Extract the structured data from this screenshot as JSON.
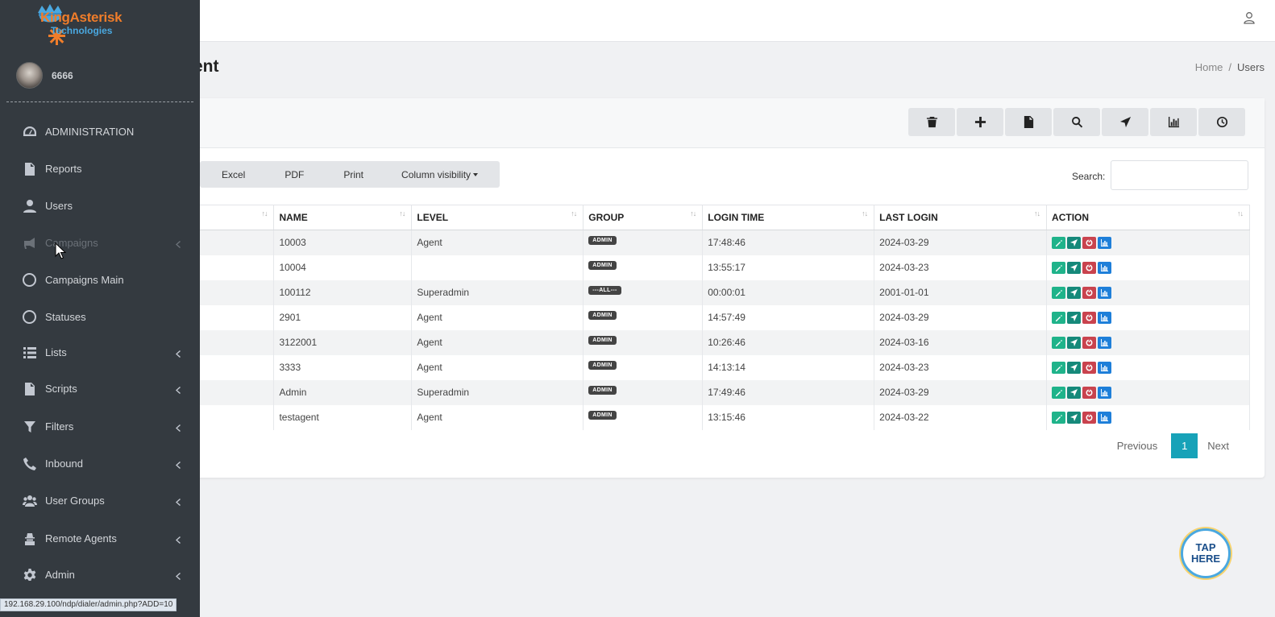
{
  "app": {
    "logo_name": "KingAsterisk",
    "logo_sub": "Technologies"
  },
  "user": {
    "name": "6666"
  },
  "header": {
    "title": "ent",
    "breadcrumb_home": "Home",
    "breadcrumb_sep": "/",
    "breadcrumb_current": "Users"
  },
  "sidebar": {
    "items": [
      {
        "label": "ADMINISTRATION",
        "icon": "dashboard-icon"
      },
      {
        "label": "Reports",
        "icon": "file-icon"
      },
      {
        "label": "Users",
        "icon": "user-icon"
      },
      {
        "label": "Campaigns",
        "icon": "megaphone-icon"
      },
      {
        "label": "Campaigns Main",
        "icon": "circle-icon"
      },
      {
        "label": "Statuses",
        "icon": "circle-icon"
      },
      {
        "label": "Lists",
        "icon": "list-icon"
      },
      {
        "label": "Scripts",
        "icon": "file-icon"
      },
      {
        "label": "Filters",
        "icon": "filter-icon"
      },
      {
        "label": "Inbound",
        "icon": "phone-icon"
      },
      {
        "label": "User Groups",
        "icon": "users-icon"
      },
      {
        "label": "Remote Agents",
        "icon": "agent-icon"
      },
      {
        "label": "Admin",
        "icon": "gear-icon"
      }
    ]
  },
  "toolbar": {
    "buttons": [
      "trash-icon",
      "plus-icon",
      "file-icon",
      "search-icon",
      "location-arrow-icon",
      "bar-chart-icon",
      "clock-icon"
    ]
  },
  "export": {
    "excel": "Excel",
    "pdf": "PDF",
    "print": "Print",
    "column_visibility": "Column visibility"
  },
  "search": {
    "label": "Search:",
    "value": ""
  },
  "table": {
    "columns": [
      "",
      "NAME",
      "LEVEL",
      "GROUP",
      "LOGIN TIME",
      "LAST LOGIN",
      "ACTION"
    ],
    "rows": [
      {
        "name": "10003",
        "level": "Agent",
        "group": "ADMIN",
        "login_time": "17:48:46",
        "last_login": "2024-03-29"
      },
      {
        "name": "10004",
        "level": "",
        "group": "ADMIN",
        "login_time": "13:55:17",
        "last_login": "2024-03-23"
      },
      {
        "name": "100112",
        "level": "Superadmin",
        "group": "---ALL---",
        "login_time": "00:00:01",
        "last_login": "2001-01-01"
      },
      {
        "name": "2901",
        "level": "Agent",
        "group": "ADMIN",
        "login_time": "14:57:49",
        "last_login": "2024-03-29"
      },
      {
        "name": "3122001",
        "level": "Agent",
        "group": "ADMIN",
        "login_time": "10:26:46",
        "last_login": "2024-03-16"
      },
      {
        "name": "3333",
        "level": "Agent",
        "group": "ADMIN",
        "login_time": "14:13:14",
        "last_login": "2024-03-23"
      },
      {
        "name": "Admin",
        "level": "Superadmin",
        "group": "ADMIN",
        "login_time": "17:49:46",
        "last_login": "2024-03-29"
      },
      {
        "name": "testagent",
        "level": "Agent",
        "group": "ADMIN",
        "login_time": "13:15:46",
        "last_login": "2024-03-22"
      }
    ]
  },
  "pagination": {
    "previous": "Previous",
    "current": "1",
    "next": "Next"
  },
  "status_url": "192.168.29.100/ndp/dialer/admin.php?ADD=10",
  "tap_here": {
    "line1": "TAP",
    "line2": "HERE"
  },
  "colors": {
    "sidebar": "#343a40",
    "accent": "#17a2b8",
    "edit": "#1fb38a",
    "send": "#15897a",
    "stop": "#c9434e",
    "stats": "#1e7fd9"
  }
}
